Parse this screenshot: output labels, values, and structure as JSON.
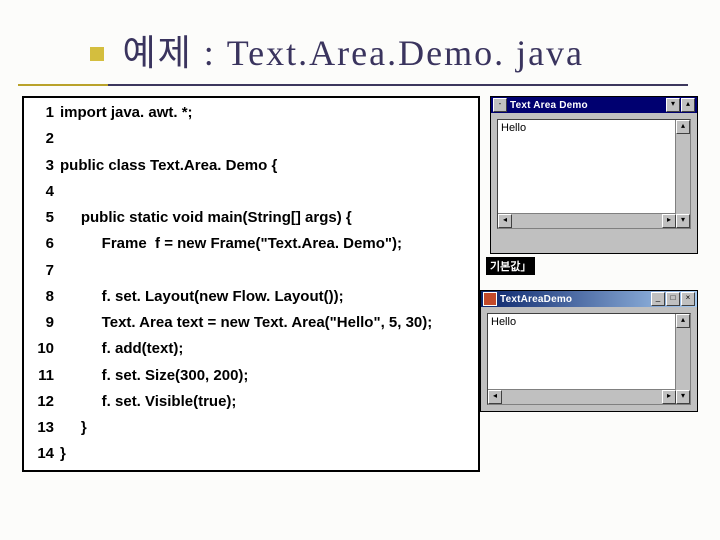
{
  "title": "예제 : Text.Area.Demo. java",
  "code": {
    "lines": [
      {
        "n": "1",
        "t": "import java. awt. *;"
      },
      {
        "n": "2",
        "t": ""
      },
      {
        "n": "3",
        "t": "public class Text.Area. Demo {"
      },
      {
        "n": "4",
        "t": ""
      },
      {
        "n": "5",
        "t": "     public static void main(String[] args) {"
      },
      {
        "n": "6",
        "t": "          Frame  f = new Frame(\"Text.Area. Demo\");"
      },
      {
        "n": "7",
        "t": ""
      },
      {
        "n": "8",
        "t": "          f. set. Layout(new Flow. Layout());"
      },
      {
        "n": "9",
        "t": "          Text. Area text = new Text. Area(\"Hello\", 5, 30);"
      },
      {
        "n": "10",
        "t": "          f. add(text);"
      },
      {
        "n": "11",
        "t": "          f. set. Size(300, 200);"
      },
      {
        "n": "12",
        "t": "          f. set. Visible(true);"
      },
      {
        "n": "13",
        "t": "     }"
      },
      {
        "n": "14",
        "t": "}"
      }
    ]
  },
  "win_top": {
    "title": "Text Area Demo",
    "content": "Hello"
  },
  "label_tag": "기본값」",
  "win_bot": {
    "title": "TextAreaDemo",
    "content": "Hello"
  }
}
